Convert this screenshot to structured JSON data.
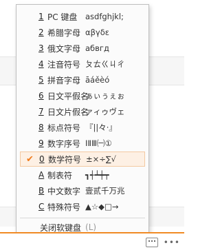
{
  "menu": {
    "items": [
      {
        "key": "1",
        "label": "PC 键盘",
        "sample": "asdfghjkl;"
      },
      {
        "key": "2",
        "label": "希腊字母",
        "sample": "αβγδε"
      },
      {
        "key": "3",
        "label": "俄文字母",
        "sample": "абвгд"
      },
      {
        "key": "4",
        "label": "注音符号",
        "sample": "ㄆㄊㄍㄐㄔ"
      },
      {
        "key": "5",
        "label": "拼音字母",
        "sample": "āáěèó"
      },
      {
        "key": "6",
        "label": "日文平假名",
        "sample": "ぁぃぅぇぉ"
      },
      {
        "key": "7",
        "label": "日文片假名",
        "sample": "ァィゥヴェ"
      },
      {
        "key": "8",
        "label": "标点符号",
        "sample": "『||々·』"
      },
      {
        "key": "9",
        "label": "数字序号",
        "sample": "ⅠⅡⅢ㈠①"
      },
      {
        "key": "0",
        "label": "数学符号",
        "sample": "±×÷∑√",
        "selected": true
      },
      {
        "key": "A",
        "label": "制表符",
        "sample": "┓┽┷┿┯"
      },
      {
        "key": "B",
        "label": "中文数字",
        "sample": "壹贰千万兆"
      },
      {
        "key": "C",
        "label": "特殊符号",
        "sample": "▲☆◆□→"
      }
    ],
    "close_label": "关闭软键盘",
    "close_hint": "(L)",
    "check_icon": "✔"
  },
  "colors": {
    "accent": "#f07a1a",
    "selected_bg": "#fdf0e4"
  },
  "tray": {
    "dots": "•••"
  }
}
